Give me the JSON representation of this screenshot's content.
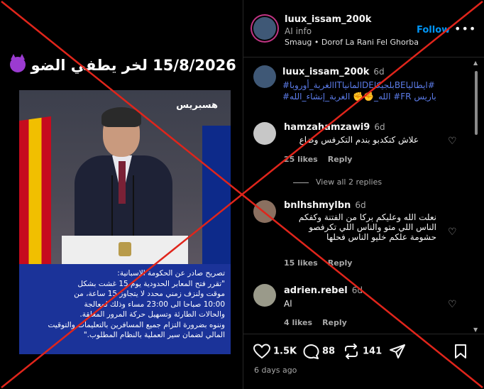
{
  "post": {
    "headline_text": "15/8/2026 لخر يطفي الضو",
    "headline_emoji": "smiling-devil-emoji",
    "logo_text": "هسبريس",
    "caption_lines": [
      "تصريح صادر عن الحكومة الإسبانية:",
      "\"تقرر فتح المعابر الحدودية يوم 15 غشت بشكل",
      "موقت ولنزف زمني محدد لا يتجاوز 15 ساعة، من",
      "10:00 صباحا الى 23:00 مساء وذلك لمعالجة",
      "والحالات الطارئة وتسهيل حركة المرور المعلقة.",
      "وننوه بضرورة التزام جميع المسافرين بالتعليمات والتوقيت",
      "المالي لضمان سير العملية بالنظام المطلوب.\""
    ]
  },
  "header": {
    "username": "luux_issam_200k",
    "follow_label": "Follow",
    "ai_info": "AI info",
    "music": "Smaug • Dorof La Rani Fel Ghorba",
    "more_icon": "more-options-icon"
  },
  "caption_comment": {
    "username": "luux_issam_200k",
    "age": "6d",
    "tags_line1": "#ايطالياBEبلجيكاDEالمانياITالغربة_أوروبا#",
    "tags_line2": "باريس FR# الله_✊✊ الغربة_إنشاء_الله#"
  },
  "comments": [
    {
      "username": "hamzahamzawi9",
      "age": "6d",
      "text_lines": [
        "علاش كتكدبو بندم التكرفس وضاع"
      ],
      "likes": "25 likes",
      "reply": "Reply"
    },
    {
      "username": "bnlhshmylbn",
      "age": "6d",
      "text_lines": [
        "نعلت الله وعليكم بركا من الفتنة وكفكم",
        "الناس اللي متو والناس اللي تكرفصو",
        "حشومة علكم خليو الناس فحلها"
      ],
      "likes": "15 likes",
      "reply": "Reply"
    },
    {
      "username": "adrien.rebel",
      "age": "6d",
      "text_lines": [
        "Al"
      ],
      "likes": "4 likes",
      "reply": "Reply"
    }
  ],
  "view_replies": "View all 2 replies",
  "actions": {
    "likes": "1.5K",
    "comments": "88",
    "reposts": "141"
  },
  "post_date": "6 days ago",
  "colors": {
    "accent": "#0095f6",
    "cross": "#e0251b",
    "caption_bg": "#1b3399"
  }
}
